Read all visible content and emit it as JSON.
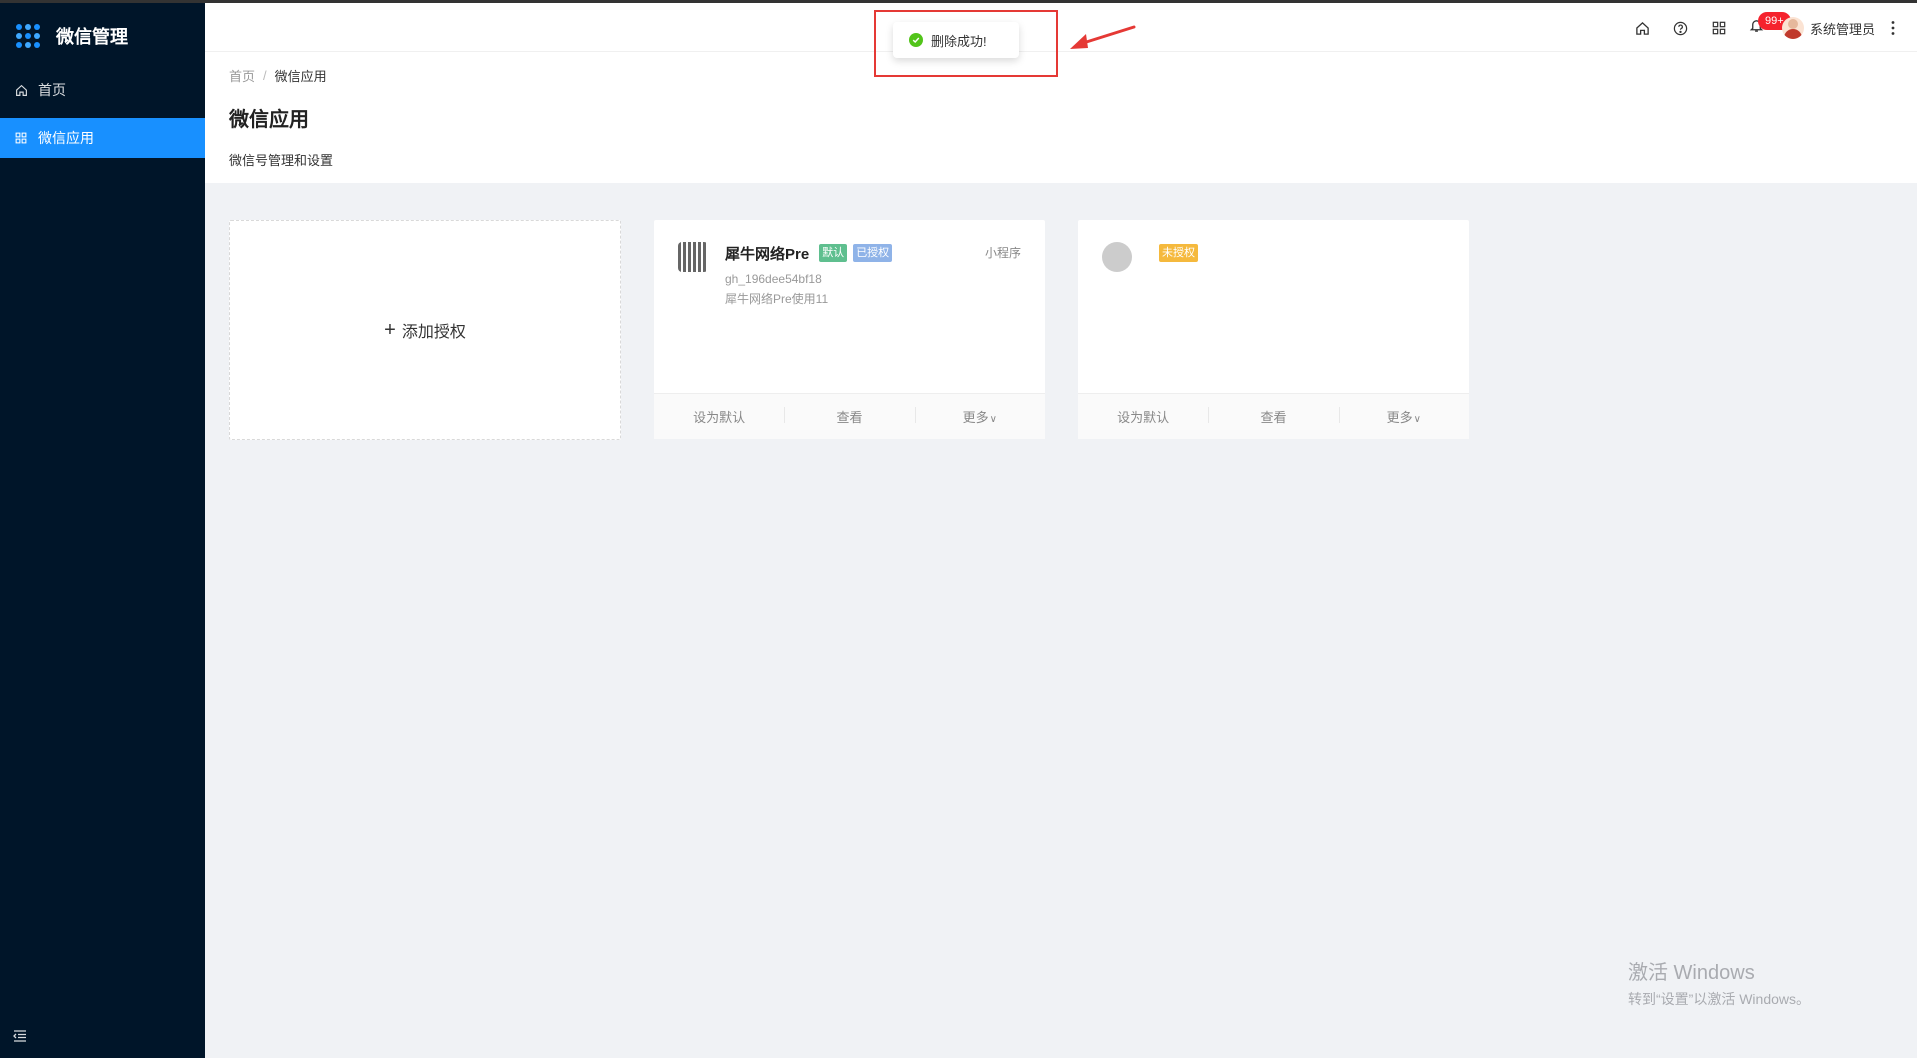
{
  "sidebar": {
    "title": "微信管理",
    "items": [
      {
        "label": "首页",
        "icon": "home-icon",
        "active": false
      },
      {
        "label": "微信应用",
        "icon": "grid-icon",
        "active": true
      }
    ]
  },
  "header": {
    "notification_count": "99+",
    "user_name": "系统管理员"
  },
  "page": {
    "breadcrumb": [
      "首页",
      "微信应用"
    ],
    "title": "微信应用",
    "description": "微信号管理和设置"
  },
  "add_card": {
    "label": "添加授权"
  },
  "cards": [
    {
      "name": "犀牛网络Pre",
      "tags": [
        "默认",
        "已授权"
      ],
      "id": "gh_196dee54bf18",
      "desc": "犀牛网络Pre使用11",
      "type": "小程序",
      "actions": [
        "设为默认",
        "查看",
        "更多"
      ]
    },
    {
      "name": "",
      "tags": [
        "未授权"
      ],
      "id": "",
      "desc": "",
      "type": "",
      "actions": [
        "设为默认",
        "查看",
        "更多"
      ]
    }
  ],
  "toast": {
    "message": "删除成功!"
  },
  "watermark": {
    "line1": "激活 Windows",
    "line2": "转到“设置”以激活 Windows。"
  },
  "colors": {
    "sidebar_bg": "#001529",
    "accent": "#1890ff",
    "success": "#52c41a",
    "badge": "#f5222d",
    "highlight_box": "#e53935"
  }
}
